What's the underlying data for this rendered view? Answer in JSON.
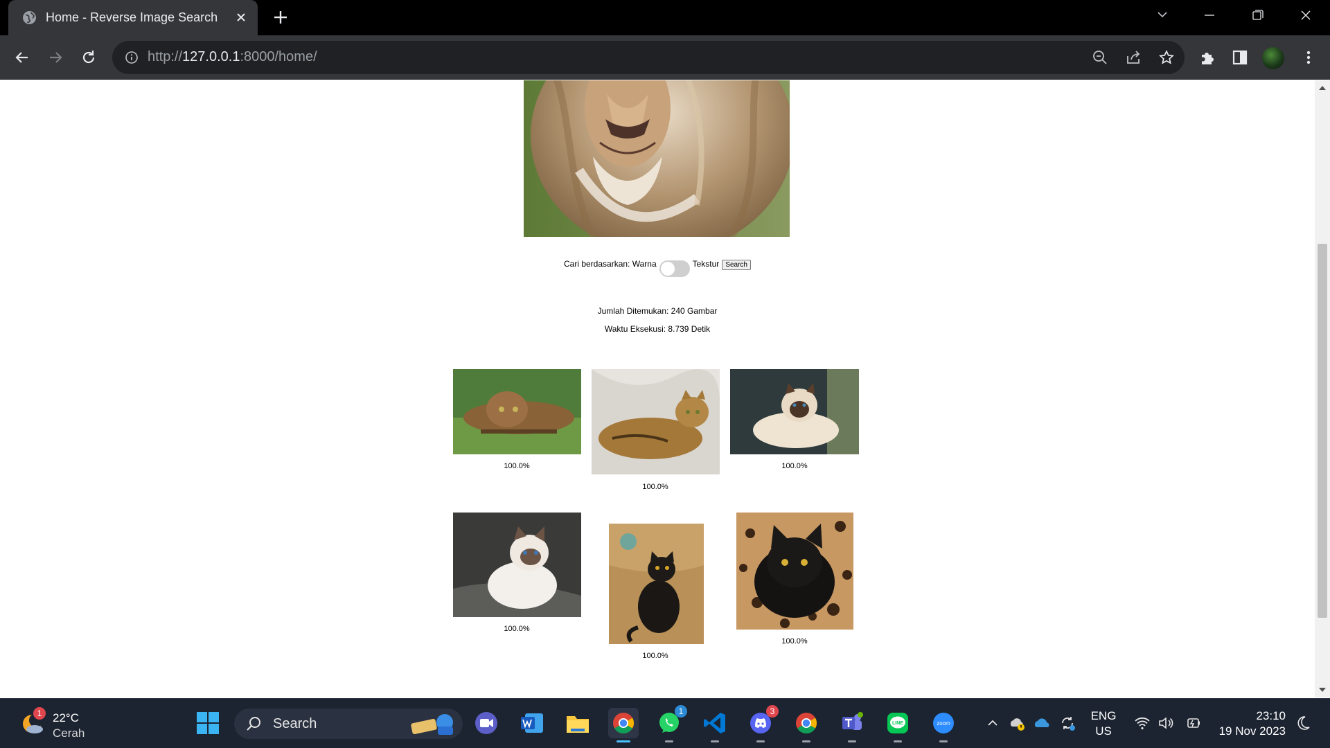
{
  "browser": {
    "tab_title": "Home - Reverse Image Search",
    "url_scheme": "http://",
    "url_host": "127.0.0.1",
    "url_rest": ":8000/home/"
  },
  "page": {
    "search_prefix": "Cari berdasarkan: Warna",
    "toggle_right_label": "Tekstur",
    "search_button": "Search",
    "count_text": "Jumlah Ditemukan: 240 Gambar",
    "time_text": "Waktu Eksekusi: 8.739 Detik",
    "results": [
      {
        "score": "100.0%",
        "subject": "bengal-cat-crouching"
      },
      {
        "score": "100.0%",
        "subject": "bengal-cat-lying"
      },
      {
        "score": "100.0%",
        "subject": "siamese-cat-lying"
      },
      {
        "score": "100.0%",
        "subject": "white-kitten"
      },
      {
        "score": "100.0%",
        "subject": "black-cat-sitting"
      },
      {
        "score": "100.0%",
        "subject": "black-cat-leopard-blanket"
      }
    ]
  },
  "taskbar": {
    "weather_temp": "22°C",
    "weather_cond": "Cerah",
    "weather_badge": "1",
    "search_label": "Search",
    "whatsapp_badge": "1",
    "discord_badge": "3",
    "lang_1": "ENG",
    "lang_2": "US",
    "time": "23:10",
    "date": "19 Nov 2023"
  },
  "colors": {
    "titlebar": "#000000",
    "toolbar": "#35363a",
    "omnibox": "#202124",
    "taskbar": "#1c2331"
  }
}
